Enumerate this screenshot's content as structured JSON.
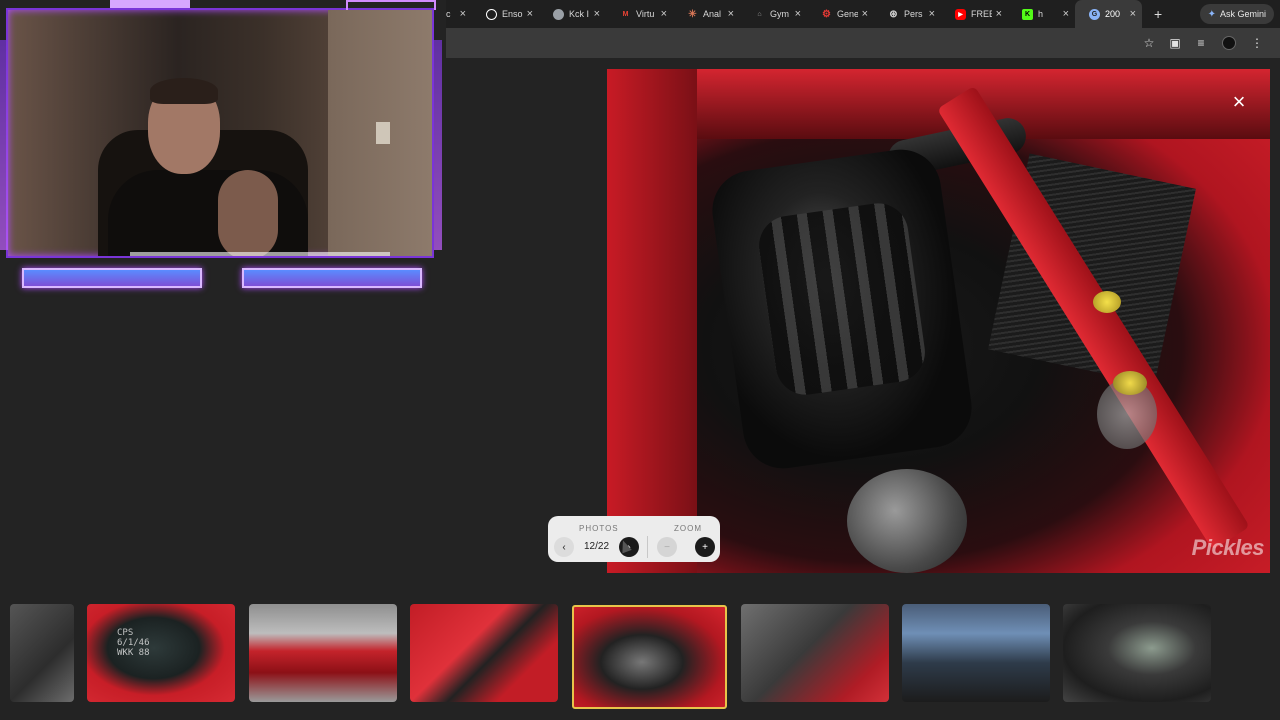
{
  "browser": {
    "tabs": [
      {
        "title": "Yc",
        "favicon": "youtube-icon",
        "color": "#ff0000",
        "active": false
      },
      {
        "title": "Enso",
        "favicon": "enso-icon",
        "color": "#ffffff",
        "active": false
      },
      {
        "title": "Kck I",
        "favicon": "kick-icon",
        "color": "#9aa0a6",
        "active": false
      },
      {
        "title": "Virtu",
        "favicon": "gmail-icon",
        "color": "#ea4335",
        "active": false
      },
      {
        "title": "Anal",
        "favicon": "claude-icon",
        "color": "#d97757",
        "active": false
      },
      {
        "title": "Gym",
        "favicon": "doc-icon",
        "color": "#777777",
        "active": false
      },
      {
        "title": "Gene",
        "favicon": "gear-icon",
        "color": "#e53935",
        "active": false
      },
      {
        "title": "Pers",
        "favicon": "chatgpt-icon",
        "color": "#cccccc",
        "active": false
      },
      {
        "title": "FREE",
        "favicon": "youtube-icon",
        "color": "#ff0000",
        "active": false
      },
      {
        "title": "h",
        "favicon": "k-icon",
        "color": "#53fc18",
        "active": false
      },
      {
        "title": "200",
        "favicon": "chrome-icon",
        "color": "#8ab4f8",
        "active": true
      }
    ],
    "new_tab": "+",
    "ask_gemini": "Ask Gemini"
  },
  "viewer": {
    "watermark": "Pickles",
    "close": "×"
  },
  "controls": {
    "photos_label": "PHOTOS",
    "zoom_label": "ZOOM",
    "counter": "12/22",
    "prev": "‹",
    "next": "›",
    "zoom_out": "−",
    "zoom_in": "+"
  },
  "thumbnails": {
    "count_visible": 8,
    "active_index": 4,
    "writing": [
      "CPS",
      "6/1/46",
      "WKK  88"
    ]
  }
}
